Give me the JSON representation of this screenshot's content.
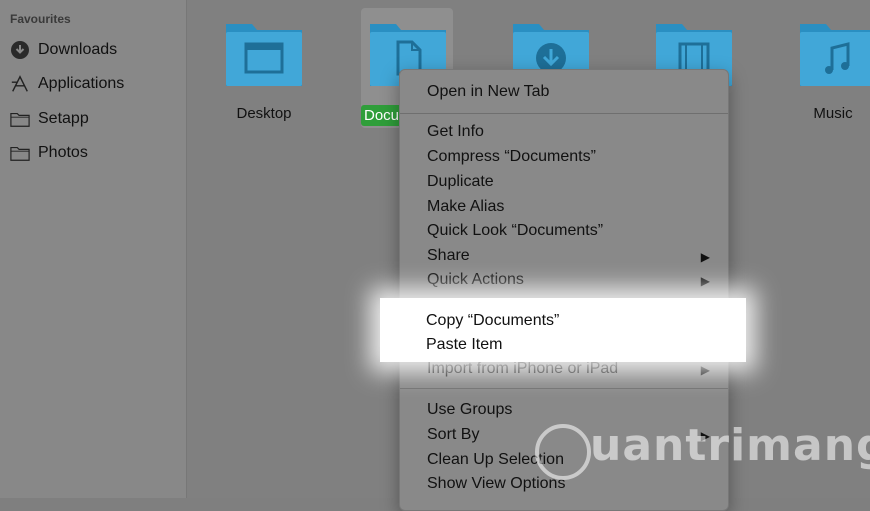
{
  "sidebar": {
    "heading": "Favourites",
    "items": [
      {
        "label": "Downloads",
        "icon": "download-circle-icon"
      },
      {
        "label": "Applications",
        "icon": "applications-icon"
      },
      {
        "label": "Setapp",
        "icon": "folder-icon"
      },
      {
        "label": "Photos",
        "icon": "folder-icon"
      }
    ]
  },
  "folders": [
    {
      "label": "Desktop",
      "icon": "desktop-folder-icon"
    },
    {
      "label": "Documents",
      "visible_label": "Docu",
      "icon": "documents-folder-icon",
      "selected": true
    },
    {
      "label": "",
      "icon": "downloads-folder-icon"
    },
    {
      "label": "",
      "icon": "movies-folder-icon"
    },
    {
      "label": "Music",
      "icon": "music-folder-icon"
    }
  ],
  "menu": {
    "group1": [
      "Open in New Tab"
    ],
    "group2": [
      "Get Info",
      "Compress “Documents”",
      "Duplicate",
      "Make Alias",
      "Quick Look “Documents”",
      "Share",
      "Quick Actions"
    ],
    "group3": [
      "Copy “Documents”",
      "Paste Item",
      "Import from iPhone or iPad"
    ],
    "group4": [
      "Use Groups",
      "Sort By",
      "Clean Up Selection",
      "Show View Options"
    ]
  },
  "watermark": "uantrimang",
  "colors": {
    "folder": "#41a7d8",
    "folder_dark": "#2a8fc2",
    "selection": "#2f9e3a"
  }
}
